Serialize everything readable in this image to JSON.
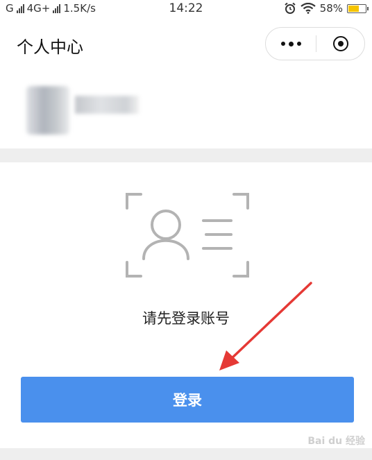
{
  "status_bar": {
    "carrier1": "G",
    "network": "4G+",
    "speed": "1.5K/s",
    "time": "14:22",
    "battery_percent": "58%",
    "battery_level": 0.58,
    "icons": [
      "alarm-icon",
      "wifi-icon",
      "battery-icon"
    ]
  },
  "nav": {
    "title": "个人中心",
    "more_icon": "more-dots-icon",
    "close_icon": "target-close-icon"
  },
  "main": {
    "hint_text": "请先登录账号",
    "login_label": "登录",
    "login_color": "#4a90ed",
    "arrow_color": "#e53935"
  },
  "watermark": {
    "text": "Bai du 经验"
  }
}
